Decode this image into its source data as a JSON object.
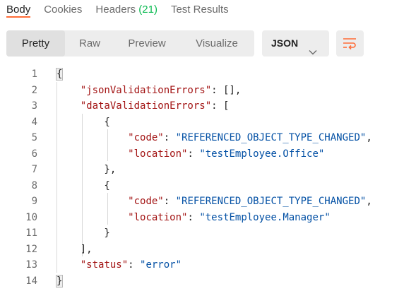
{
  "tabs": [
    {
      "label": "Body",
      "count": ""
    },
    {
      "label": "Cookies",
      "count": ""
    },
    {
      "label": "Headers",
      "count": "(21)"
    },
    {
      "label": "Test Results",
      "count": ""
    }
  ],
  "view_modes": [
    "Pretty",
    "Raw",
    "Preview",
    "Visualize"
  ],
  "active_view_mode": "Pretty",
  "format_select": {
    "value": "JSON"
  },
  "icons": {
    "format_chevron": "chevron-down-icon",
    "wrap": "wrap-lines-icon"
  },
  "colors": {
    "accent": "#ff6c37",
    "count": "#0cbb52",
    "json_key": "#a31515",
    "json_string": "#0451a5"
  },
  "code": {
    "line_numbers": [
      "1",
      "2",
      "3",
      "4",
      "5",
      "6",
      "7",
      "8",
      "9",
      "10",
      "11",
      "12",
      "13",
      "14"
    ],
    "lines": [
      [
        {
          "t": "{",
          "c": "p",
          "hl": true
        }
      ],
      [
        {
          "t": "    ",
          "c": "p"
        },
        {
          "t": "\"jsonValidationErrors\"",
          "c": "key"
        },
        {
          "t": ": [],",
          "c": "p"
        }
      ],
      [
        {
          "t": "    ",
          "c": "p"
        },
        {
          "t": "\"dataValidationErrors\"",
          "c": "key"
        },
        {
          "t": ": [",
          "c": "p"
        }
      ],
      [
        {
          "t": "        {",
          "c": "p"
        }
      ],
      [
        {
          "t": "            ",
          "c": "p"
        },
        {
          "t": "\"code\"",
          "c": "key"
        },
        {
          "t": ": ",
          "c": "p"
        },
        {
          "t": "\"REFERENCED_OBJECT_TYPE_CHANGED\"",
          "c": "str"
        },
        {
          "t": ",",
          "c": "p"
        }
      ],
      [
        {
          "t": "            ",
          "c": "p"
        },
        {
          "t": "\"location\"",
          "c": "key"
        },
        {
          "t": ": ",
          "c": "p"
        },
        {
          "t": "\"testEmployee.Office\"",
          "c": "str"
        }
      ],
      [
        {
          "t": "        },",
          "c": "p"
        }
      ],
      [
        {
          "t": "        {",
          "c": "p"
        }
      ],
      [
        {
          "t": "            ",
          "c": "p"
        },
        {
          "t": "\"code\"",
          "c": "key"
        },
        {
          "t": ": ",
          "c": "p"
        },
        {
          "t": "\"REFERENCED_OBJECT_TYPE_CHANGED\"",
          "c": "str"
        },
        {
          "t": ",",
          "c": "p"
        }
      ],
      [
        {
          "t": "            ",
          "c": "p"
        },
        {
          "t": "\"location\"",
          "c": "key"
        },
        {
          "t": ": ",
          "c": "p"
        },
        {
          "t": "\"testEmployee.Manager\"",
          "c": "str"
        }
      ],
      [
        {
          "t": "        }",
          "c": "p"
        }
      ],
      [
        {
          "t": "    ],",
          "c": "p"
        }
      ],
      [
        {
          "t": "    ",
          "c": "p"
        },
        {
          "t": "\"status\"",
          "c": "key"
        },
        {
          "t": ": ",
          "c": "p"
        },
        {
          "t": "\"error\"",
          "c": "str"
        }
      ],
      [
        {
          "t": "}",
          "c": "p",
          "hl": true
        }
      ]
    ]
  }
}
